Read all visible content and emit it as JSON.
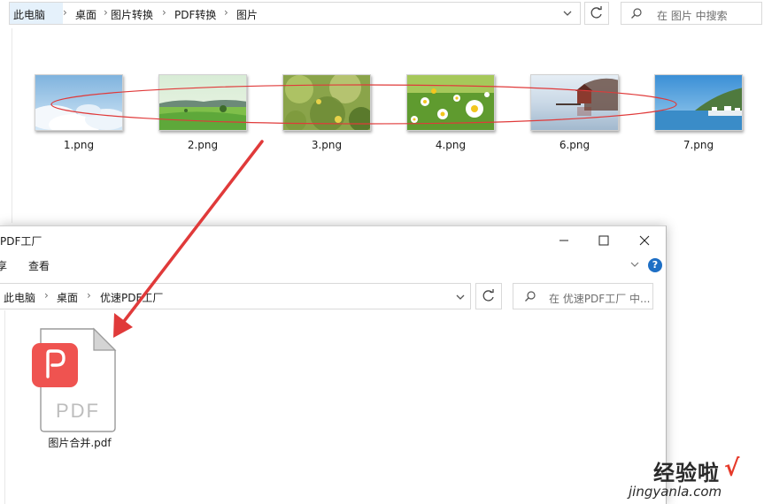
{
  "background_window": {
    "breadcrumb": [
      "此电脑",
      "桌面",
      "图片转换",
      "PDF转换",
      "图片"
    ],
    "search_placeholder": "在 图片 中搜索",
    "files": [
      {
        "name": "1.png",
        "scene": "sky-clouds"
      },
      {
        "name": "2.png",
        "scene": "green-field"
      },
      {
        "name": "3.png",
        "scene": "green-foliage"
      },
      {
        "name": "4.png",
        "scene": "daisies"
      },
      {
        "name": "6.png",
        "scene": "misty-lake-house"
      },
      {
        "name": "7.png",
        "scene": "harbor-boats"
      }
    ]
  },
  "foreground_window": {
    "title": "PDF工厂",
    "ribbon_tabs": [
      "享",
      "查看"
    ],
    "breadcrumb": [
      "此电脑",
      "桌面",
      "优速PDF工厂"
    ],
    "search_placeholder": "在 优速PDF工厂 中...",
    "file": {
      "name": "图片合并.pdf",
      "icon_text": "PDF"
    }
  },
  "watermark": {
    "brand": "经验啦",
    "url": "jingyanla.com"
  },
  "colors": {
    "annotation_red": "#e03a3a",
    "pdf_badge": "#ef5350",
    "help_blue": "#1e6fc5"
  },
  "icons": {
    "chevron": "chevron-down-icon",
    "refresh": "refresh-icon",
    "search": "search-icon",
    "minimize": "minimize-icon",
    "maximize": "maximize-icon",
    "close": "close-icon",
    "help": "help-icon",
    "pdf": "pdf-file-icon"
  }
}
